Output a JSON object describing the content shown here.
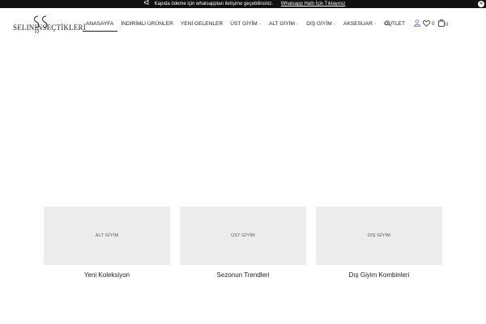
{
  "announcement": {
    "message": "Kapıda ödeme için whatsapptan iletişime geçebilirsiniz.",
    "link": "Whatsapp Hattı İçin Tıklayınız"
  },
  "logo": {
    "text": "SELININSEÇTİKLERİ"
  },
  "nav": {
    "items": [
      {
        "label": "ANASAYFA",
        "dropdown": false
      },
      {
        "label": "İNDİRİMLİ ÜRÜNLER",
        "dropdown": false
      },
      {
        "label": "YENİ GELENLER",
        "dropdown": false
      },
      {
        "label": "ÜST GİYİM",
        "dropdown": true
      },
      {
        "label": "ALT GİYİM",
        "dropdown": true
      },
      {
        "label": "DIŞ GİYİM",
        "dropdown": true
      },
      {
        "label": "AKSESUAR",
        "dropdown": true
      },
      {
        "label": "OUTLET",
        "dropdown": false
      }
    ],
    "active": "ANASAYFA"
  },
  "header_icons": {
    "search": "search-icon",
    "user": "user-icon",
    "wishlist": "heart-icon",
    "cart": "bag-icon",
    "wishlist_count": "0",
    "cart_count": "0"
  },
  "categories": [
    {
      "image_label": "ALT GİYİM",
      "title": "Yeni Koleksiyon"
    },
    {
      "image_label": "ÜST GİYİM",
      "title": "Sezonun Trendleri"
    },
    {
      "image_label": "DIŞ GİYİM",
      "title": "Dış Giyim Kombinleri"
    }
  ],
  "colors": {
    "topbar_bg": "#111111",
    "thumb_bg": "#ececec",
    "text": "#222222"
  }
}
